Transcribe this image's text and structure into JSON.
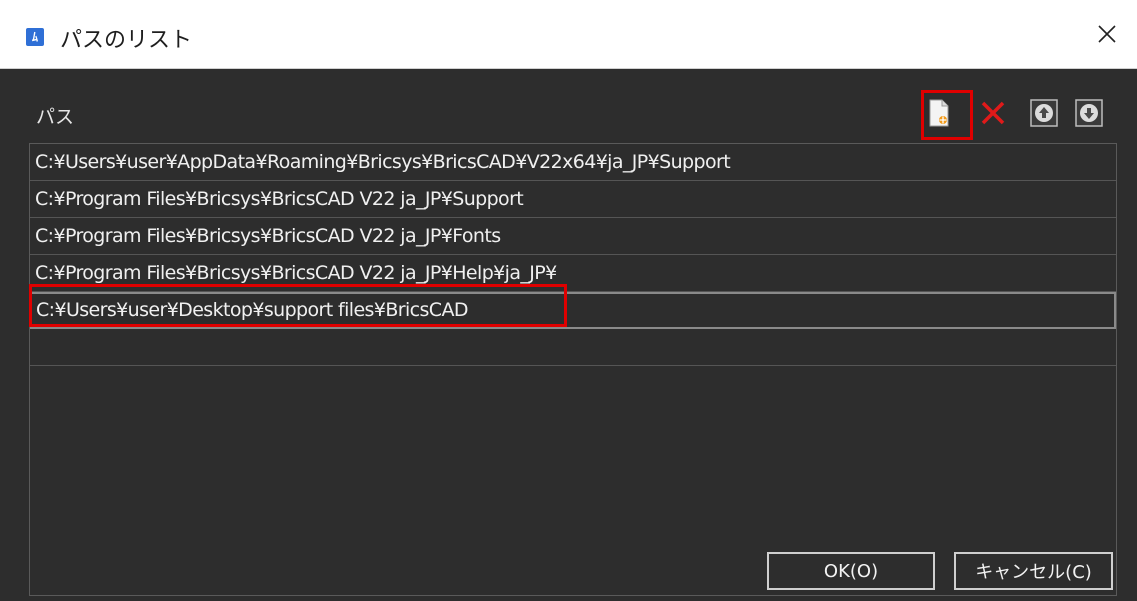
{
  "window": {
    "title": "パスのリスト",
    "app_icon_glyph": "ﾑ"
  },
  "panel": {
    "label": "パス"
  },
  "toolbar": {
    "icons": [
      "new-path-icon",
      "delete-icon",
      "move-up-icon",
      "move-down-icon"
    ],
    "colors": {
      "delete": "#e01a1a",
      "highlight": "#e00000"
    }
  },
  "paths": [
    "C:¥Users¥user¥AppData¥Roaming¥Bricsys¥BricsCAD¥V22x64¥ja_JP¥Support",
    "C:¥Program Files¥Bricsys¥BricsCAD V22 ja_JP¥Support",
    "C:¥Program Files¥Bricsys¥BricsCAD V22 ja_JP¥Fonts",
    "C:¥Program Files¥Bricsys¥BricsCAD V22 ja_JP¥Help¥ja_JP¥",
    "C:¥Users¥user¥Desktop¥support files¥BricsCAD",
    ""
  ],
  "buttons": {
    "ok": "OK(O)",
    "cancel": "キャンセル(C)"
  }
}
